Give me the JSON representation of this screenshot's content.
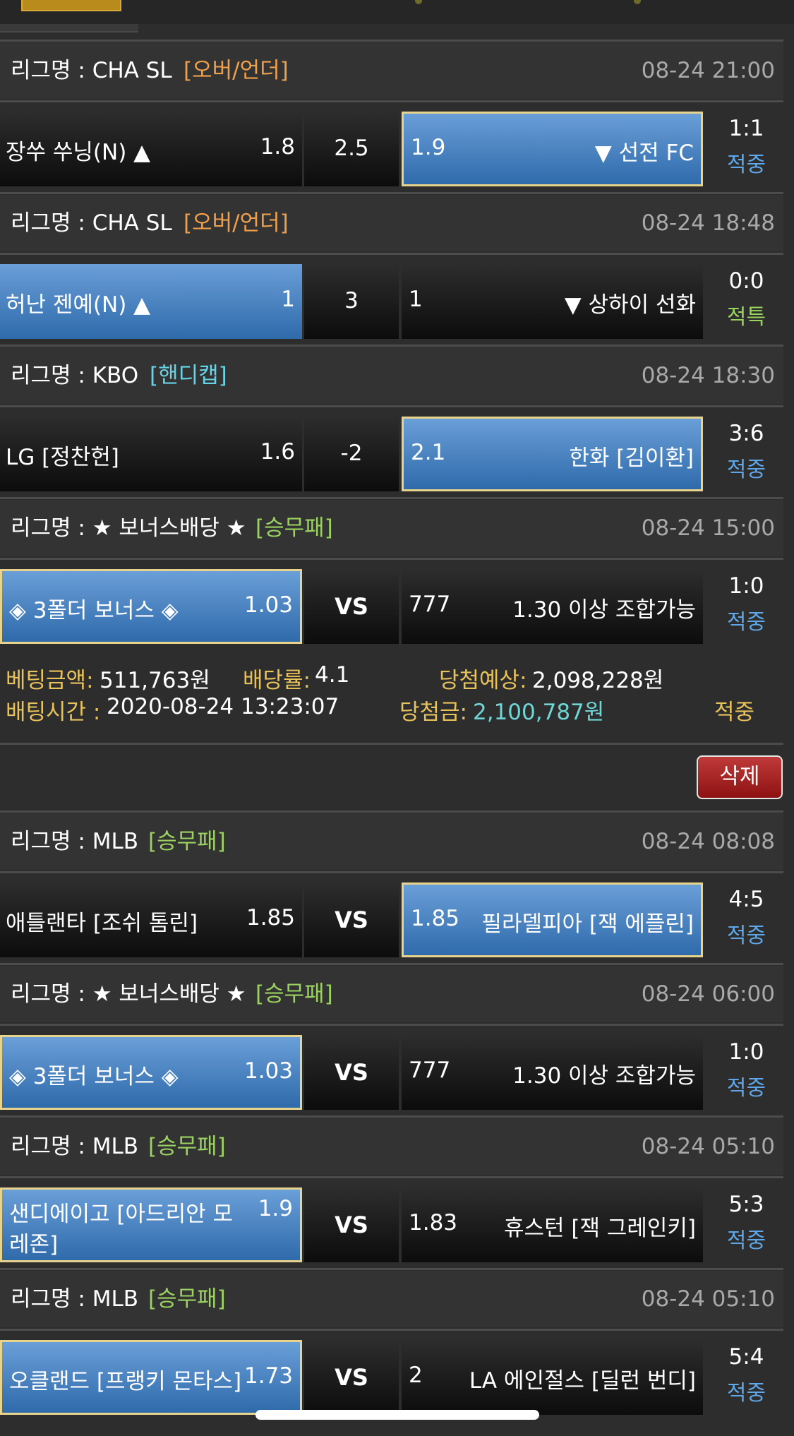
{
  "colors": {
    "accent_orange": "#f0a04b",
    "accent_cyan": "#66d3e6",
    "accent_green": "#9bd35f",
    "status_blue": "#5fa7e8",
    "info_yellow": "#e8c25a",
    "win_amount": "#6fd6d6",
    "delete_red": "#b02828"
  },
  "bets": [
    {
      "league": "리그명 : CHA SL",
      "tag": "[오버/언더]",
      "date": "08-24 21:00",
      "home": "장쑤 쑤닝(N) ▲",
      "home_odds": "1.8",
      "center": "2.5",
      "away_odds": "1.9",
      "away": "▼ 선전 FC",
      "score": "1:1",
      "status": "적중"
    },
    {
      "league": "리그명 : CHA SL",
      "tag": "[오버/언더]",
      "date": "08-24 18:48",
      "home": "허난 젠예(N) ▲",
      "home_odds": "1",
      "center": "3",
      "away_odds": "1",
      "away": "▼ 상하이 선화",
      "score": "0:0",
      "status": "적특"
    },
    {
      "league": "리그명 : KBO",
      "tag": "[핸디캡]",
      "date": "08-24 18:30",
      "home": "LG [정찬헌]",
      "home_odds": "1.6",
      "center": "-2",
      "away_odds": "2.1",
      "away": "한화 [김이환]",
      "score": "3:6",
      "status": "적중"
    },
    {
      "league": "리그명 : ★ 보너스배당 ★",
      "tag": "[승무패]",
      "date": "08-24 15:00",
      "home": "◈ 3폴더 보너스 ◈",
      "home_odds": "1.03",
      "center": "VS",
      "away_odds": "777",
      "away": "1.30 이상 조합가능",
      "score": "1:0",
      "status": "적중"
    },
    {
      "league": "리그명 : MLB",
      "tag": "[승무패]",
      "date": "08-24 08:08",
      "home": "애틀랜타 [조쉬 톰린]",
      "home_odds": "1.85",
      "center": "VS",
      "away_odds": "1.85",
      "away": "필라델피아 [잭 에플린]",
      "score": "4:5",
      "status": "적중"
    },
    {
      "league": "리그명 : ★ 보너스배당 ★",
      "tag": "[승무패]",
      "date": "08-24 06:00",
      "home": "◈ 3폴더 보너스 ◈",
      "home_odds": "1.03",
      "center": "VS",
      "away_odds": "777",
      "away": "1.30 이상 조합가능",
      "score": "1:0",
      "status": "적중"
    },
    {
      "league": "리그명 : MLB",
      "tag": "[승무패]",
      "date": "08-24 05:10",
      "home_line1": "샌디에이고 [아드리안 모",
      "home_line2": "레존]",
      "home_odds": "1.9",
      "center": "VS",
      "away_odds": "1.83",
      "away": "휴스턴 [잭 그레인키]",
      "score": "5:3",
      "status": "적중"
    },
    {
      "league": "리그명 : MLB",
      "tag": "[승무패]",
      "date": "08-24 05:10",
      "home": "오클랜드 [프랭키 몬타스]",
      "home_odds": "1.73",
      "center": "VS",
      "away_odds": "2",
      "away": "LA 에인절스 [딜런 번디]",
      "score": "5:4",
      "status": "적중"
    }
  ],
  "summary": {
    "bet_amount_label": "베팅금액:",
    "bet_amount": "511,763원",
    "odds_label": "배당률:",
    "odds": "4.1",
    "expected_label": "당첨예상:",
    "expected": "2,098,228원",
    "time_label": "배팅시간 :",
    "time": "2020-08-24 13:23:07",
    "win_label": "당첨금:",
    "win": "2,100,787원",
    "result": "적중"
  },
  "delete_label": "삭제"
}
